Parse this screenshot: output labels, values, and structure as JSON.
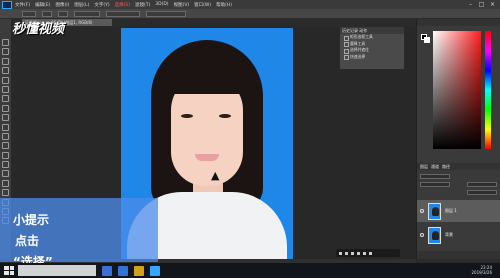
{
  "menubar": {
    "items": [
      "文件(F)",
      "编辑(E)",
      "图像(I)",
      "图层(L)",
      "文字(Y)",
      "选择(S)",
      "滤镜(T)",
      "3D(D)",
      "视图(V)",
      "窗口(W)",
      "帮助(H)"
    ],
    "active_index": 5
  },
  "doc_tab": "证件照.jpg @ 66.7%(图层1, RGB/8)",
  "watermark": "秒懂视频",
  "actions": {
    "tab": "历史记录 动作",
    "rows": [
      "矩形选框工具",
      "魔棒工具",
      "选择并遮住",
      "快速选择"
    ]
  },
  "layers": {
    "tabs": [
      "图层",
      "通道",
      "路径"
    ],
    "rows": [
      {
        "name": "图层 1",
        "selected": true
      },
      {
        "name": "背景",
        "selected": false
      }
    ]
  },
  "tips": {
    "line1": "小提示",
    "line2": "点击",
    "line3": "“选择”"
  },
  "clock": {
    "time": "23:24",
    "date": "2019/3/26"
  },
  "colors": {
    "photo_bg": "#1f87e8",
    "tip_panel": "#4c8ceb",
    "active_menu": "#ff5a5a"
  }
}
